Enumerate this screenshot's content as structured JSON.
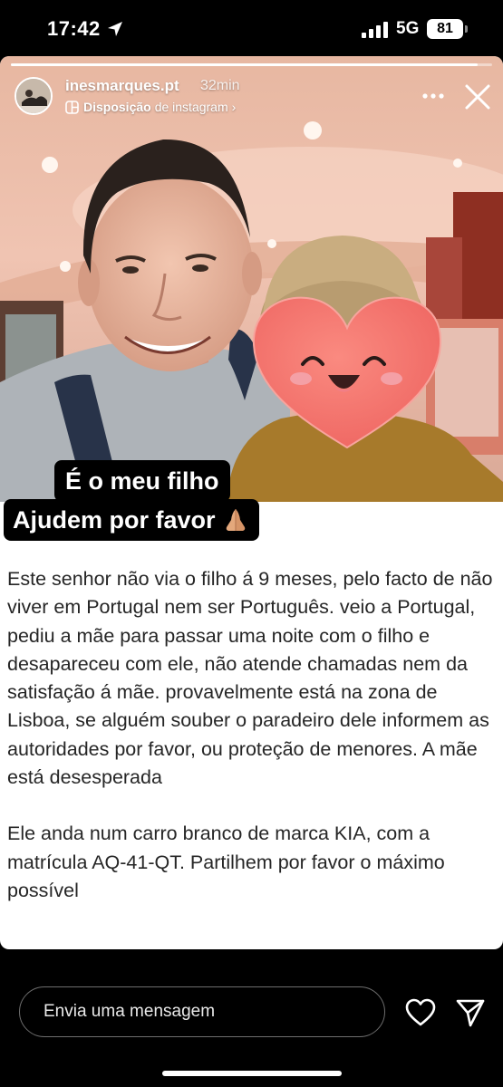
{
  "status_bar": {
    "time": "17:42",
    "network": "5G",
    "battery": "81"
  },
  "story": {
    "progress": 0.97,
    "username": "inesmarques.pt",
    "time_ago": "32min",
    "layout_label": "Disposição",
    "layout_suffix": "de instagram",
    "caption_line_1": "É o meu filho",
    "caption_line_2": "Ajudem por favor",
    "body_paragraph_1": "Este senhor não via o filho á 9 meses, pelo facto de não viver em Portugal nem ser Português. veio a Portugal, pediu a mãe para passar uma noite com o filho e desapareceu com ele, não atende chamadas nem da satisfação á mãe. provavelmente está na zona de Lisboa, se alguém souber o paradeiro dele informem as autoridades por favor, ou proteção de menores. A mãe está desesperada",
    "body_paragraph_2": "Ele anda num carro branco de marca KIA, com a matrícula AQ-41-QT. Partilhem por favor o máximo possível"
  },
  "reply_bar": {
    "placeholder": "Envia uma mensagem"
  },
  "icons": {
    "location": "location-arrow-icon",
    "signal": "cellular-signal-icon",
    "layout": "layout-grid-icon",
    "more": "more-horizontal-icon",
    "close": "close-icon",
    "heart": "heart-icon",
    "send": "send-icon",
    "emoji": "folded-hands-emoji",
    "sticker": "smiling-heart-sticker"
  },
  "colors": {
    "background": "#000000",
    "card": "#ffffff",
    "body_text": "#262626",
    "heart_sticker": "#f4756d"
  }
}
